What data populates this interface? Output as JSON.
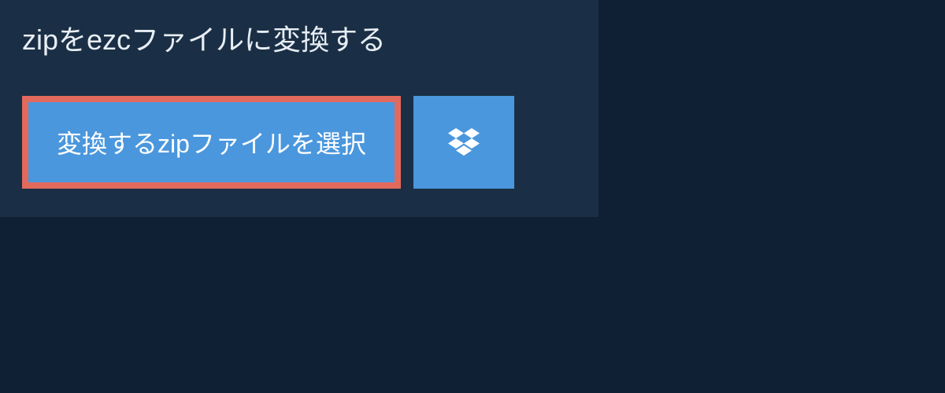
{
  "title": "zipをezcファイルに変換する",
  "select_button_label": "変換するzipファイルを選択"
}
